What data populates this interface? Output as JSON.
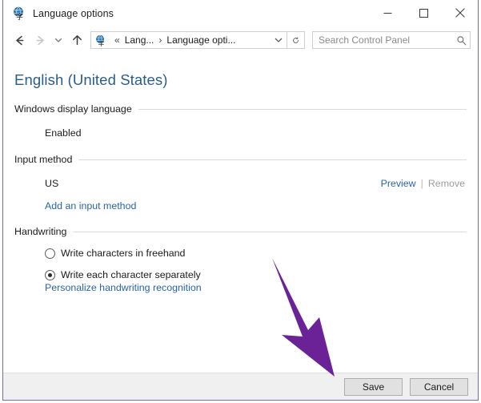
{
  "window": {
    "title": "Language options",
    "icon": "language-globe-icon",
    "controls": {
      "minimize": "minimize-icon",
      "maximize": "maximize-icon",
      "close": "close-icon"
    }
  },
  "navbar": {
    "back": "back-arrow-icon",
    "forward": "forward-arrow-icon",
    "recent": "chevron-down-icon",
    "up": "up-arrow-icon",
    "breadcrumb": {
      "icon": "language-globe-icon",
      "overflow": "«",
      "items": [
        "Lang...",
        "Language opti..."
      ],
      "separator": "›",
      "dropdown": "chevron-down-icon"
    },
    "refresh": "refresh-icon",
    "search": {
      "placeholder": "Search Control Panel",
      "value": "",
      "icon": "search-icon"
    }
  },
  "main": {
    "heading": "English (United States)",
    "sections": [
      {
        "title": "Windows display language",
        "status": "Enabled"
      },
      {
        "title": "Input method",
        "item": "US",
        "preview_label": "Preview",
        "pipe": "|",
        "remove_label": "Remove",
        "add_link": "Add an input method"
      },
      {
        "title": "Handwriting",
        "options": [
          {
            "label": "Write characters in freehand",
            "selected": false
          },
          {
            "label": "Write each character separately",
            "selected": true
          }
        ],
        "personalize_link": "Personalize handwriting recognition"
      }
    ]
  },
  "footer": {
    "save_label": "Save",
    "cancel_label": "Cancel"
  },
  "annotation": {
    "type": "arrow",
    "color": "#6b2296",
    "points_to": "save-button"
  }
}
